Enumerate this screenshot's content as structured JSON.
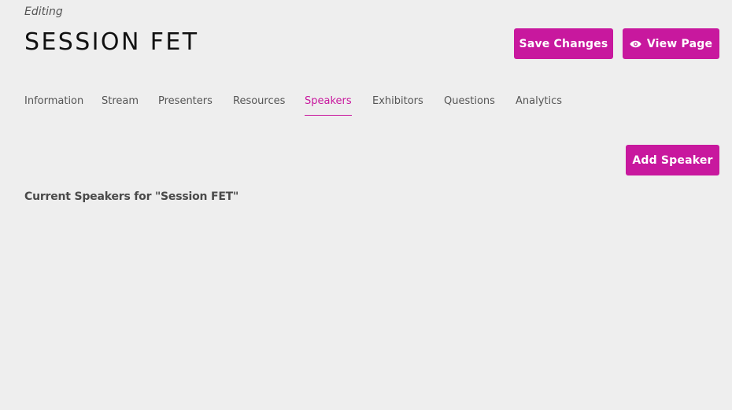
{
  "header": {
    "editing_label": "Editing",
    "title": "SESSION FET",
    "save_label": "Save Changes",
    "view_label": "View Page"
  },
  "tabs": [
    {
      "label": "Information",
      "active": false
    },
    {
      "label": "Stream",
      "active": false
    },
    {
      "label": "Presenters",
      "active": false
    },
    {
      "label": "Resources",
      "active": false
    },
    {
      "label": "Speakers",
      "active": true
    },
    {
      "label": "Exhibitors",
      "active": false
    },
    {
      "label": "Questions",
      "active": false
    },
    {
      "label": "Analytics",
      "active": false
    }
  ],
  "speakers": {
    "add_label": "Add Speaker",
    "heading": "Current Speakers for \"Session FET\""
  },
  "icons": {
    "view": "eye-icon"
  },
  "colors": {
    "accent": "#c8189e",
    "background": "#eeeeee",
    "title": "#111111"
  }
}
